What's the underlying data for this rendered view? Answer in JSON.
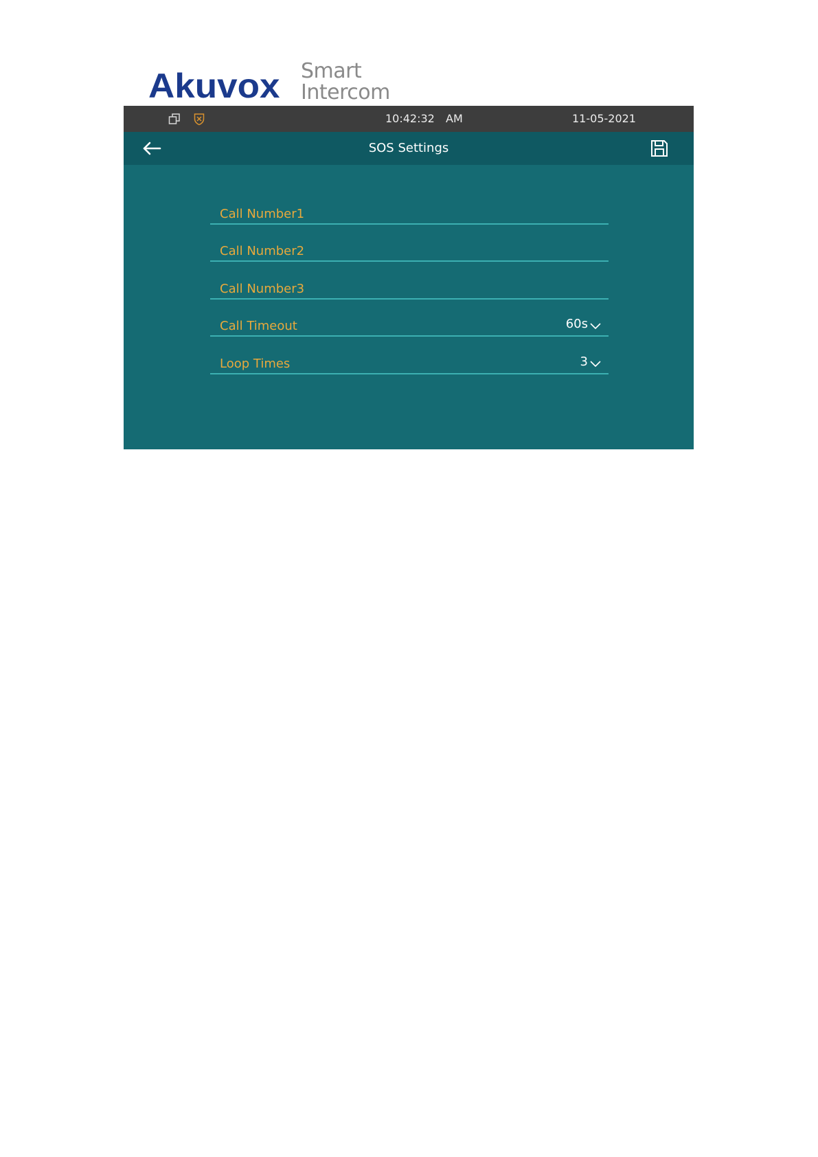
{
  "logo": {
    "brand": "Akuvox",
    "tagline_line1": "Smart",
    "tagline_line2": "Intercom"
  },
  "status_bar": {
    "time": "10:42:32",
    "ampm": "AM",
    "date": "11-05-2021",
    "icons": [
      "windows-copy-icon",
      "shield-icon"
    ]
  },
  "header": {
    "title": "SOS Settings",
    "back_icon": "arrow-left-icon",
    "save_icon": "floppy-save-icon"
  },
  "form": {
    "rows": [
      {
        "label": "Call Number1",
        "value": ""
      },
      {
        "label": "Call Number2",
        "value": ""
      },
      {
        "label": "Call Number3",
        "value": ""
      },
      {
        "label": "Call Timeout",
        "value": "60s"
      },
      {
        "label": "Loop Times",
        "value": "3"
      }
    ]
  },
  "colors": {
    "screen_bg": "#156b73",
    "title_bg": "#0f5962",
    "status_bg": "#3d3d3d",
    "label": "#e8a93c",
    "divider": "#3cb0b2",
    "brand": "#1b3a8c"
  }
}
